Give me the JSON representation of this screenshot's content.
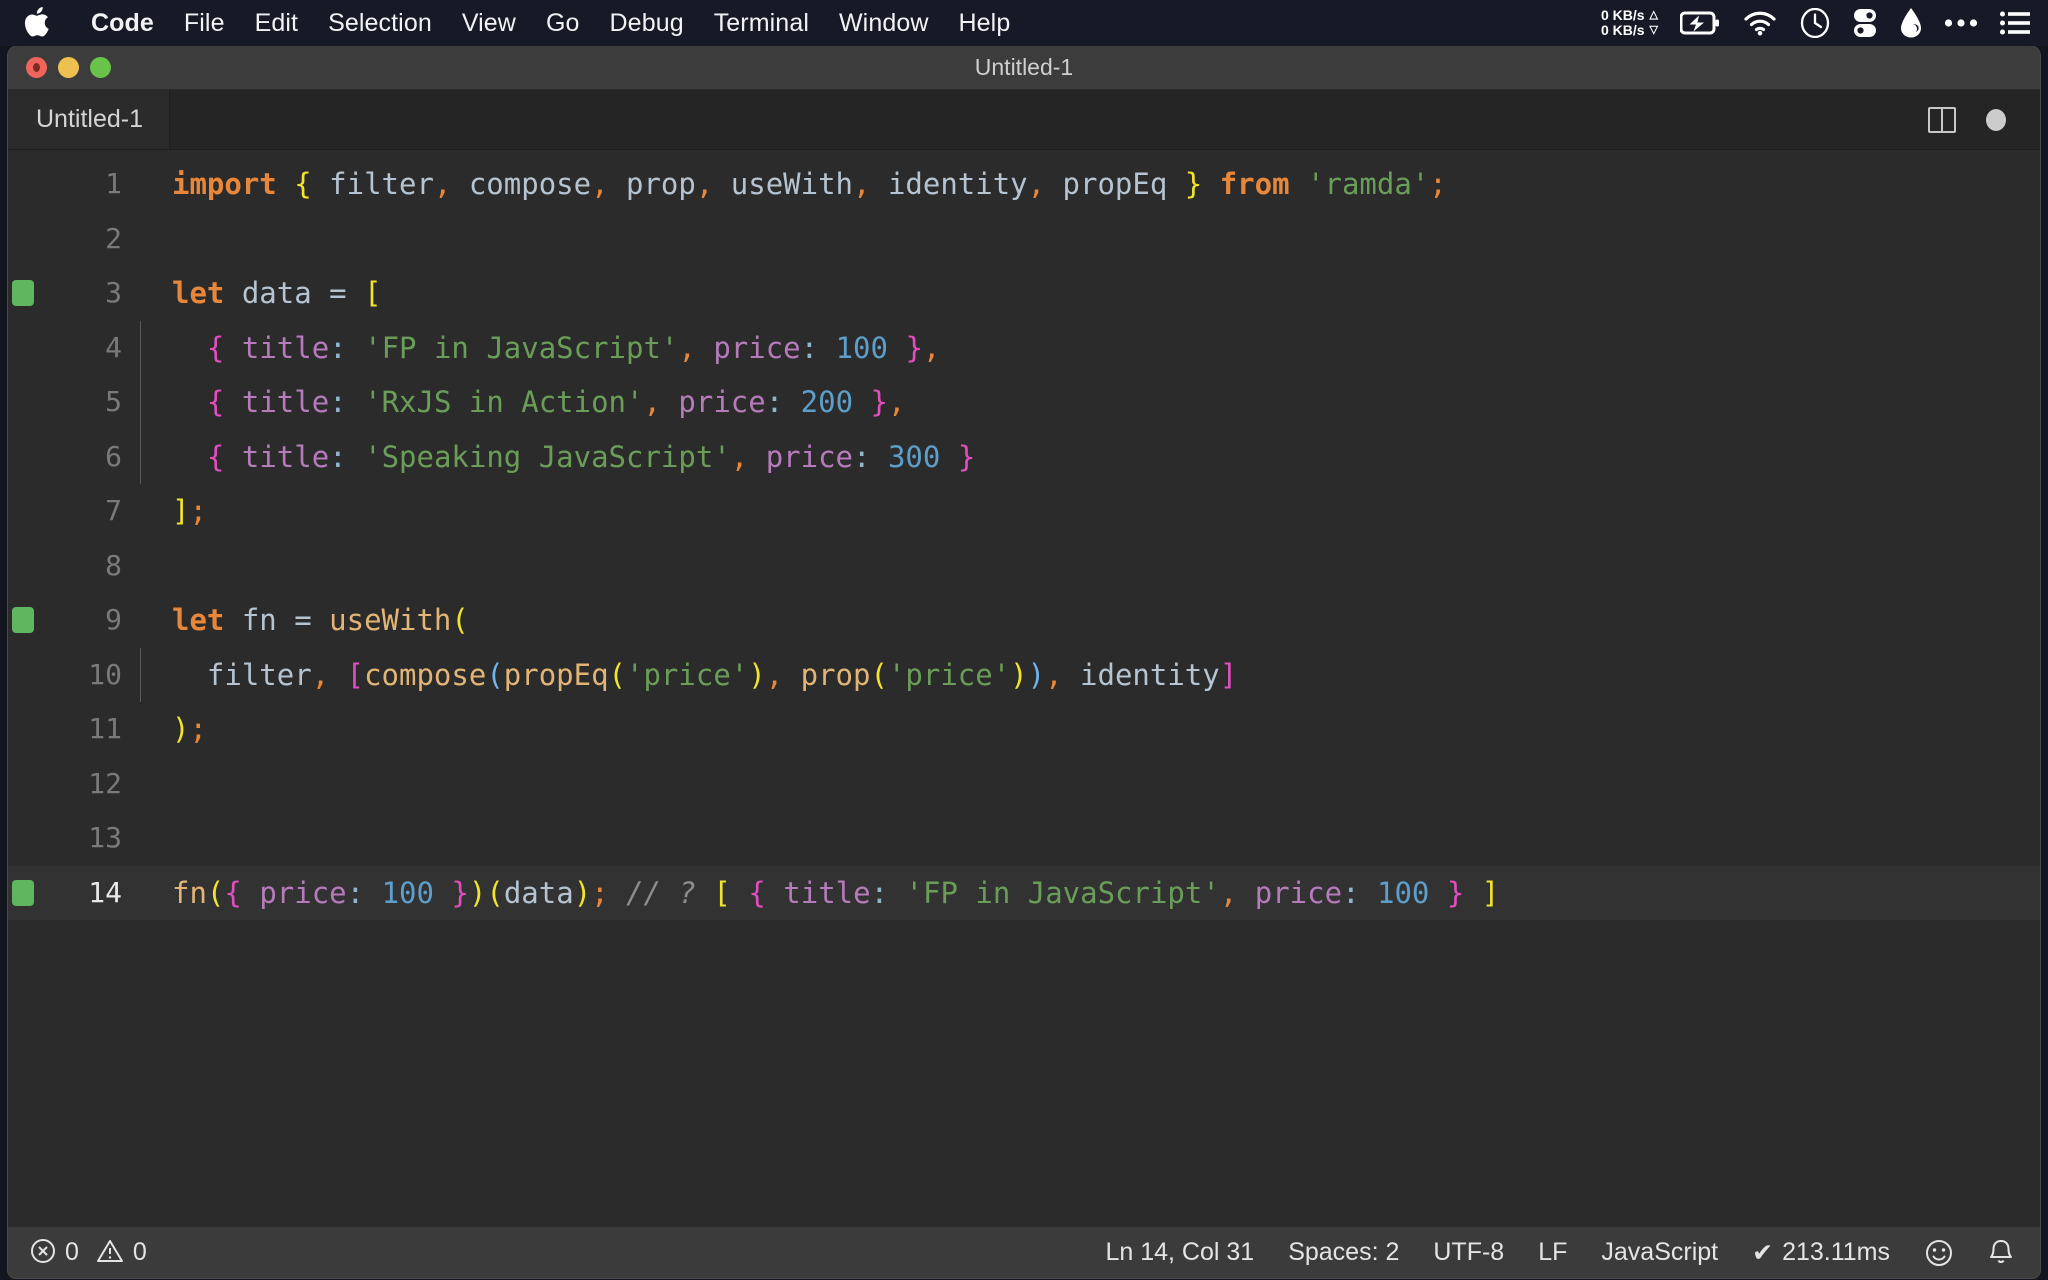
{
  "menubar": {
    "apple_icon": "apple-logo",
    "items": [
      {
        "label": "Code",
        "bold": true
      },
      {
        "label": "File",
        "bold": false
      },
      {
        "label": "Edit",
        "bold": false
      },
      {
        "label": "Selection",
        "bold": false
      },
      {
        "label": "View",
        "bold": false
      },
      {
        "label": "Go",
        "bold": false
      },
      {
        "label": "Debug",
        "bold": false
      },
      {
        "label": "Terminal",
        "bold": false
      },
      {
        "label": "Window",
        "bold": false
      },
      {
        "label": "Help",
        "bold": false
      }
    ],
    "network": {
      "upload": "0 KB/s",
      "download": "0 KB/s",
      "up_arrow": "△",
      "down_arrow": "▽"
    },
    "status_icons": [
      "battery-charging-icon",
      "wifi-icon",
      "clock-icon",
      "toggles-icon",
      "drop-icon",
      "ellipsis-icon",
      "list-menu-icon"
    ]
  },
  "window": {
    "title": "Untitled-1",
    "traffic_lights": [
      "close-button",
      "minimize-button",
      "maximize-button"
    ]
  },
  "tabbar": {
    "tab_label": "Untitled-1",
    "split_editor_icon": "split-editor-icon",
    "unsaved_indicator": "dirty-dot-icon"
  },
  "editor": {
    "lines": [
      {
        "num": "1",
        "git": false,
        "guide": false,
        "active": false
      },
      {
        "num": "2",
        "git": false,
        "guide": false,
        "active": false
      },
      {
        "num": "3",
        "git": true,
        "guide": false,
        "active": false
      },
      {
        "num": "4",
        "git": false,
        "guide": true,
        "active": false
      },
      {
        "num": "5",
        "git": false,
        "guide": true,
        "active": false
      },
      {
        "num": "6",
        "git": false,
        "guide": true,
        "active": false
      },
      {
        "num": "7",
        "git": false,
        "guide": false,
        "active": false
      },
      {
        "num": "8",
        "git": false,
        "guide": false,
        "active": false
      },
      {
        "num": "9",
        "git": true,
        "guide": false,
        "active": false
      },
      {
        "num": "10",
        "git": false,
        "guide": true,
        "active": false
      },
      {
        "num": "11",
        "git": false,
        "guide": false,
        "active": false
      },
      {
        "num": "12",
        "git": false,
        "guide": false,
        "active": false
      },
      {
        "num": "13",
        "git": false,
        "guide": false,
        "active": false
      },
      {
        "num": "14",
        "git": true,
        "guide": false,
        "active": true
      }
    ],
    "source_text": [
      "import { filter, compose, prop, useWith, identity, propEq } from 'ramda';",
      "",
      "let data = [",
      "  { title: 'FP in JavaScript', price: 100 },",
      "  { title: 'RxJS in Action', price: 200 },",
      "  { title: 'Speaking JavaScript', price: 300 }",
      "];",
      "",
      "let fn = useWith(",
      "  filter, [compose(propEq('price'), prop('price')), identity]",
      ");",
      "",
      "",
      "fn({ price: 100 })(data); // ? [ { title: 'FP in JavaScript', price: 100 } ]"
    ]
  },
  "statusbar": {
    "errors_icon": "error-circle-icon",
    "errors_count": "0",
    "warnings_icon": "warning-triangle-icon",
    "warnings_count": "0",
    "cursor_position": "Ln 14, Col 31",
    "indentation": "Spaces: 2",
    "encoding": "UTF-8",
    "eol": "LF",
    "language": "JavaScript",
    "quokka_icon": "✔",
    "quokka_time": "213.11ms",
    "feedback_icon": "smiley-icon",
    "notifications_icon": "bell-icon"
  },
  "colors": {
    "menubar_bg": "#171a26",
    "titlebar_bg": "#3c3c3c",
    "tabbar_bg": "#252526",
    "editor_bg": "#2b2b2b",
    "statusbar_bg": "#3b3b3b",
    "keyword": "#e8873a",
    "string": "#6a9e58",
    "number": "#5d9ecb",
    "property": "#b57bba",
    "function": "#e2b576",
    "bracket_yellow": "#f2e42c",
    "bracket_pink": "#e14ec0",
    "bracket_blue": "#6fb4ee",
    "comment": "#8d8d8d",
    "git_added": "#5fb65f"
  }
}
